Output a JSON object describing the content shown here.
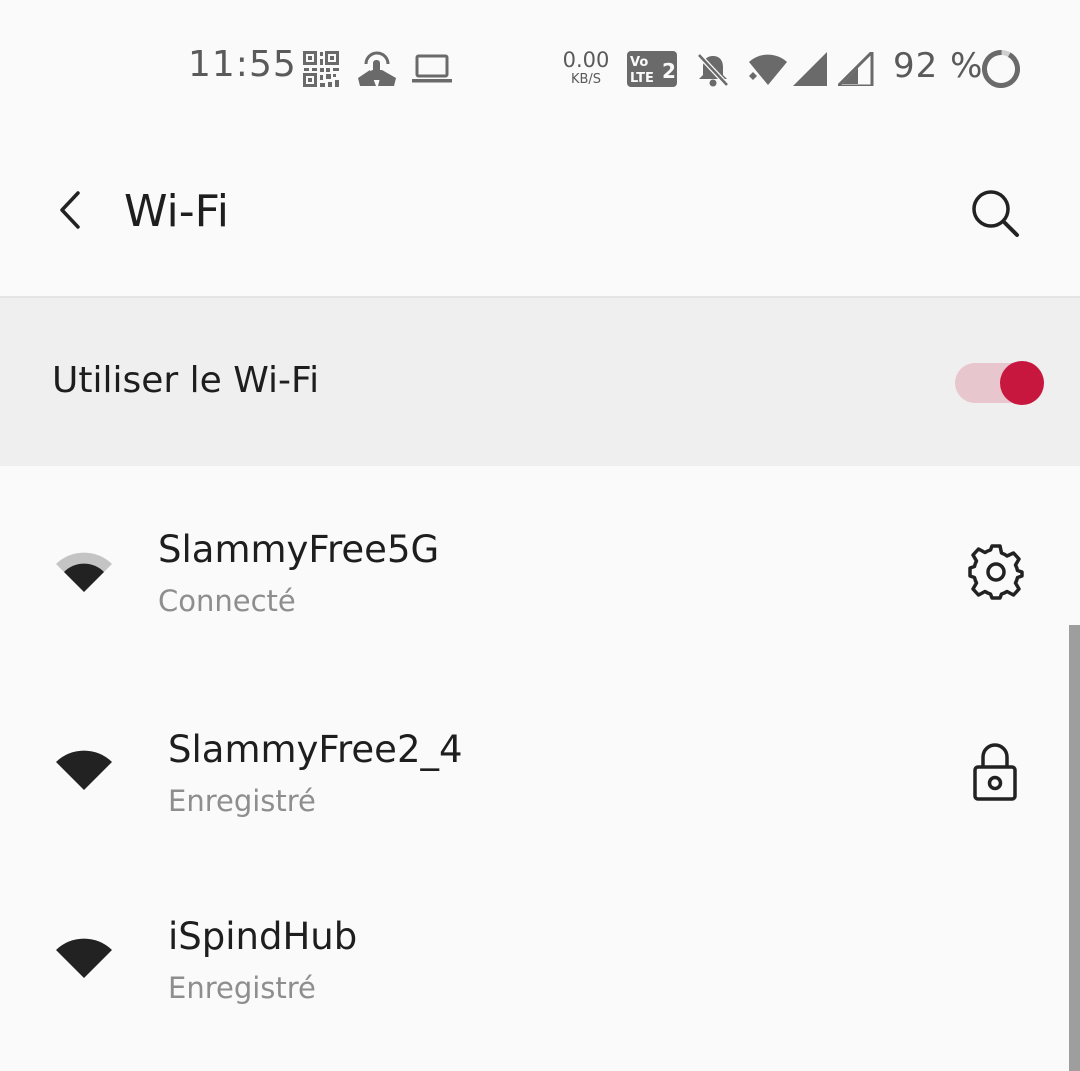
{
  "status_bar": {
    "time": "11:55",
    "notification_icons": [
      "qr-code-icon",
      "hand-touch-icon",
      "laptop-icon"
    ],
    "net_speed_value": "0.00",
    "net_speed_unit": "KB/S",
    "volte_label": "Vo LTE 2",
    "status_icons": [
      "volte-icon",
      "bell-off-icon",
      "wifi-icon",
      "signal-full-icon",
      "signal-weak-icon"
    ],
    "battery_percent": "92 %",
    "battery_icon": "battery-ring-icon"
  },
  "toolbar": {
    "back_icon": "back-arrow-icon",
    "title": "Wi-Fi",
    "search_icon": "search-icon"
  },
  "master_switch": {
    "label": "Utiliser le Wi-Fi",
    "enabled": true,
    "accent_color": "#c8173f",
    "track_color": "#e8c6ce"
  },
  "networks": [
    {
      "ssid": "SlammyFree5G",
      "status": "Connecté",
      "signal_icon": "wifi-signal-medium-icon",
      "action_icon": "gear-icon"
    },
    {
      "ssid": "SlammyFree2_4",
      "status": "Enregistré",
      "signal_icon": "wifi-signal-low-icon",
      "action_icon": "lock-icon"
    },
    {
      "ssid": "iSpindHub",
      "status": "Enregistré",
      "signal_icon": "wifi-signal-low-icon",
      "action_icon": ""
    }
  ]
}
